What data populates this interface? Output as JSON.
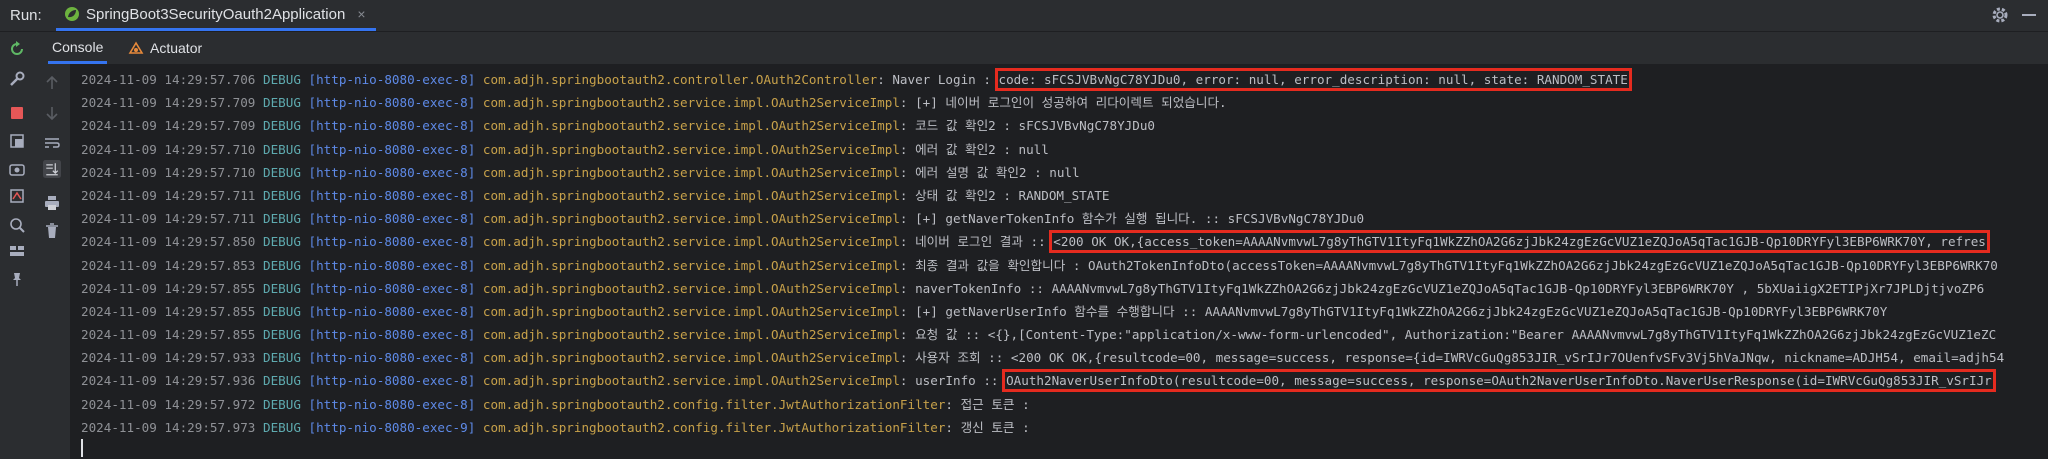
{
  "run_label": "Run:",
  "run_tab": {
    "label": "SpringBoot3SecurityOauth2Application",
    "close": "×",
    "icon": "spring-leaf-icon"
  },
  "subtabs": [
    {
      "label": "Console",
      "active": true
    },
    {
      "label": "Actuator",
      "active": false,
      "icon": "actuator-icon"
    }
  ],
  "left_toolbar_icons": [
    "rerun-icon",
    "wrench-icon",
    "stop-icon",
    "restore-layout-icon",
    "screenshot-icon",
    "dump-threads-icon",
    "coverage-icon",
    "layout-icon",
    "pin-icon"
  ],
  "console_toolbar_icons": [
    "scroll-up-icon",
    "scroll-down-icon",
    "soft-wrap-icon",
    "scroll-to-end-icon",
    "print-icon",
    "clear-icon"
  ],
  "colors": {
    "accent": "#3574f0",
    "highlight_box": "#e52b1f",
    "spring": "#6db33f"
  },
  "log": [
    {
      "ts": "2024-11-09 14:29:57.706",
      "level": "DEBUG",
      "thread": "[http-nio-8080-exec-8]",
      "logger": "com.adjh.springbootauth2.controller.OAuth2Controller",
      "msg_pre": ": Naver Login : ",
      "msg_box": "code: sFCSJVBvNgC78YJDu0, error: null, error_description: null, state: RANDOM_STATE",
      "msg_post": ""
    },
    {
      "ts": "2024-11-09 14:29:57.709",
      "level": "DEBUG",
      "thread": "[http-nio-8080-exec-8]",
      "logger": "com.adjh.springbootauth2.service.impl.OAuth2ServiceImpl",
      "msg_pre": ": [+] 네이버 로그인이 성공하여 리다이렉트 되었습니다.",
      "msg_box": "",
      "msg_post": ""
    },
    {
      "ts": "2024-11-09 14:29:57.709",
      "level": "DEBUG",
      "thread": "[http-nio-8080-exec-8]",
      "logger": "com.adjh.springbootauth2.service.impl.OAuth2ServiceImpl",
      "msg_pre": ": 코드 값 확인2 : sFCSJVBvNgC78YJDu0",
      "msg_box": "",
      "msg_post": ""
    },
    {
      "ts": "2024-11-09 14:29:57.710",
      "level": "DEBUG",
      "thread": "[http-nio-8080-exec-8]",
      "logger": "com.adjh.springbootauth2.service.impl.OAuth2ServiceImpl",
      "msg_pre": ": 에러 값 확인2 : null",
      "msg_box": "",
      "msg_post": ""
    },
    {
      "ts": "2024-11-09 14:29:57.710",
      "level": "DEBUG",
      "thread": "[http-nio-8080-exec-8]",
      "logger": "com.adjh.springbootauth2.service.impl.OAuth2ServiceImpl",
      "msg_pre": ": 에러 설명 값 확인2 : null",
      "msg_box": "",
      "msg_post": ""
    },
    {
      "ts": "2024-11-09 14:29:57.711",
      "level": "DEBUG",
      "thread": "[http-nio-8080-exec-8]",
      "logger": "com.adjh.springbootauth2.service.impl.OAuth2ServiceImpl",
      "msg_pre": ": 상태 값 확인2 : RANDOM_STATE",
      "msg_box": "",
      "msg_post": ""
    },
    {
      "ts": "2024-11-09 14:29:57.711",
      "level": "DEBUG",
      "thread": "[http-nio-8080-exec-8]",
      "logger": "com.adjh.springbootauth2.service.impl.OAuth2ServiceImpl",
      "msg_pre": ": [+] getNaverTokenInfo 함수가 실행 됩니다. :: sFCSJVBvNgC78YJDu0",
      "msg_box": "",
      "msg_post": ""
    },
    {
      "ts": "2024-11-09 14:29:57.850",
      "level": "DEBUG",
      "thread": "[http-nio-8080-exec-8]",
      "logger": "com.adjh.springbootauth2.service.impl.OAuth2ServiceImpl",
      "msg_pre": ": 네이버 로그인 결과 :: ",
      "msg_box": "<200 OK OK,{access_token=AAAANvmvwL7g8yThGTV1ItyFq1WkZZhOA2G6zjJbk24zgEzGcVUZ1eZQJoA5qTac1GJB-Qp10DRYFyl3EBP6WRK70Y, refres",
      "msg_post": ""
    },
    {
      "ts": "2024-11-09 14:29:57.853",
      "level": "DEBUG",
      "thread": "[http-nio-8080-exec-8]",
      "logger": "com.adjh.springbootauth2.service.impl.OAuth2ServiceImpl",
      "msg_pre": ": 최종 결과 값을 확인합니다 : OAuth2TokenInfoDto(accessToken=AAAANvmvwL7g8yThGTV1ItyFq1WkZZhOA2G6zjJbk24zgEzGcVUZ1eZQJoA5qTac1GJB-Qp10DRYFyl3EBP6WRK70",
      "msg_box": "",
      "msg_post": ""
    },
    {
      "ts": "2024-11-09 14:29:57.855",
      "level": "DEBUG",
      "thread": "[http-nio-8080-exec-8]",
      "logger": "com.adjh.springbootauth2.service.impl.OAuth2ServiceImpl",
      "msg_pre": ": naverTokenInfo :: AAAANvmvwL7g8yThGTV1ItyFq1WkZZhOA2G6zjJbk24zgEzGcVUZ1eZQJoA5qTac1GJB-Qp10DRYFyl3EBP6WRK70Y , 5bXUaiigX2ETIPjXr7JPLDjtjvoZP6",
      "msg_box": "",
      "msg_post": ""
    },
    {
      "ts": "2024-11-09 14:29:57.855",
      "level": "DEBUG",
      "thread": "[http-nio-8080-exec-8]",
      "logger": "com.adjh.springbootauth2.service.impl.OAuth2ServiceImpl",
      "msg_pre": ": [+] getNaverUserInfo 함수를 수행합니다 :: AAAANvmvwL7g8yThGTV1ItyFq1WkZZhOA2G6zjJbk24zgEzGcVUZ1eZQJoA5qTac1GJB-Qp10DRYFyl3EBP6WRK70Y",
      "msg_box": "",
      "msg_post": ""
    },
    {
      "ts": "2024-11-09 14:29:57.855",
      "level": "DEBUG",
      "thread": "[http-nio-8080-exec-8]",
      "logger": "com.adjh.springbootauth2.service.impl.OAuth2ServiceImpl",
      "msg_pre": ": 요청 값 :: <{},[Content-Type:\"application/x-www-form-urlencoded\", Authorization:\"Bearer AAAANvmvwL7g8yThGTV1ItyFq1WkZZhOA2G6zjJbk24zgEzGcVUZ1eZC",
      "msg_box": "",
      "msg_post": ""
    },
    {
      "ts": "2024-11-09 14:29:57.933",
      "level": "DEBUG",
      "thread": "[http-nio-8080-exec-8]",
      "logger": "com.adjh.springbootauth2.service.impl.OAuth2ServiceImpl",
      "msg_pre": ": 사용자 조회 :: <200 OK OK,{resultcode=00, message=success, response={id=IWRVcGuQg853JIR_vSrIJr7OUenfvSFv3Vj5hVaJNqw, nickname=ADJH54, email=adjh54",
      "msg_box": "",
      "msg_post": ""
    },
    {
      "ts": "2024-11-09 14:29:57.936",
      "level": "DEBUG",
      "thread": "[http-nio-8080-exec-8]",
      "logger": "com.adjh.springbootauth2.service.impl.OAuth2ServiceImpl",
      "msg_pre": ": userInfo :: ",
      "msg_box": "OAuth2NaverUserInfoDto(resultcode=00, message=success, response=OAuth2NaverUserInfoDto.NaverUserResponse(id=IWRVcGuQg853JIR_vSrIJr",
      "msg_post": ""
    },
    {
      "ts": "2024-11-09 14:29:57.972",
      "level": "DEBUG",
      "thread": "[http-nio-8080-exec-8]",
      "logger": "com.adjh.springbootauth2.config.filter.JwtAuthorizationFilter",
      "msg_pre": ": 접근 토큰 :",
      "msg_box": "",
      "msg_post": ""
    },
    {
      "ts": "2024-11-09 14:29:57.973",
      "level": "DEBUG",
      "thread": "[http-nio-8080-exec-9]",
      "logger": "com.adjh.springbootauth2.config.filter.JwtAuthorizationFilter",
      "msg_pre": ": 갱신 토큰 :",
      "msg_box": "",
      "msg_post": ""
    }
  ]
}
